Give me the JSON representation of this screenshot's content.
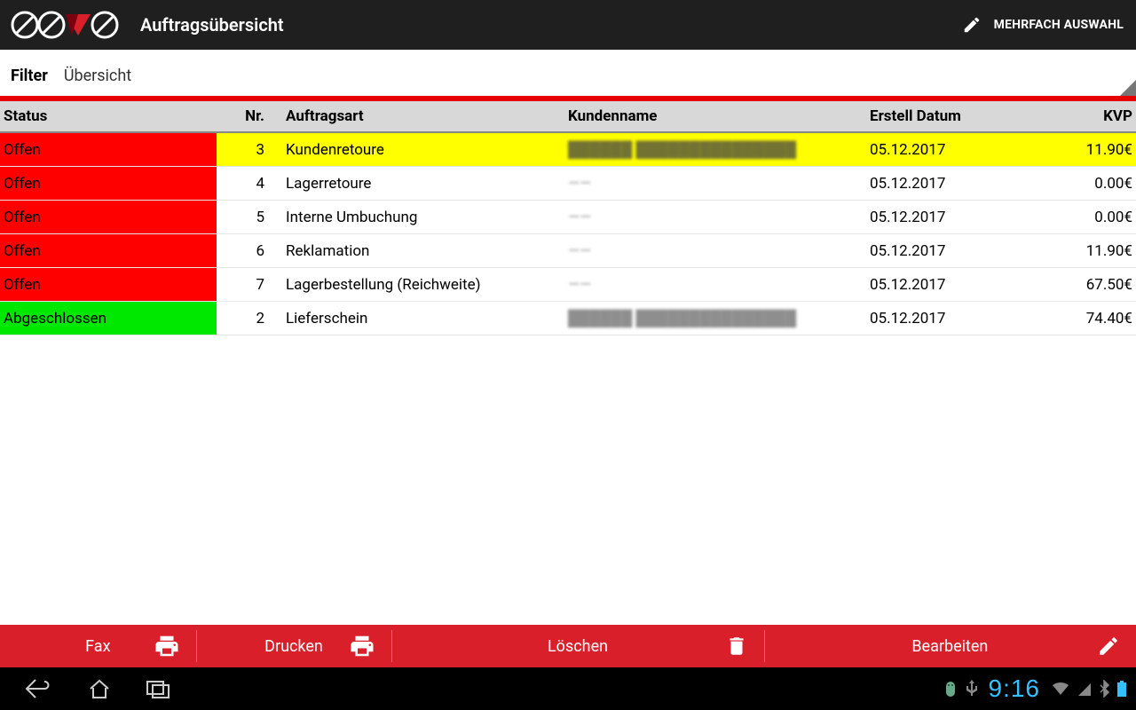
{
  "header": {
    "title": "Auftragsübersicht",
    "multi_select_label": "MEHRFACH AUSWAHL"
  },
  "filter": {
    "label": "Filter",
    "overview": "Übersicht"
  },
  "table": {
    "headers": {
      "status": "Status",
      "nr": "Nr.",
      "art": "Auftragsart",
      "kunde": "Kundenname",
      "date": "Erstell Datum",
      "kvp": "KVP"
    },
    "rows": [
      {
        "status": "Offen",
        "status_kind": "open",
        "nr": "3",
        "art": "Kundenretoure",
        "kunde": "██████ ███████████████",
        "date": "05.12.2017",
        "kvp": "11.90€",
        "selected": true
      },
      {
        "status": "Offen",
        "status_kind": "open",
        "nr": "4",
        "art": "Lagerretoure",
        "kunde": "——",
        "date": "05.12.2017",
        "kvp": "0.00€",
        "selected": false
      },
      {
        "status": "Offen",
        "status_kind": "open",
        "nr": "5",
        "art": "Interne Umbuchung",
        "kunde": "——",
        "date": "05.12.2017",
        "kvp": "0.00€",
        "selected": false
      },
      {
        "status": "Offen",
        "status_kind": "open",
        "nr": "6",
        "art": "Reklamation",
        "kunde": "——",
        "date": "05.12.2017",
        "kvp": "11.90€",
        "selected": false
      },
      {
        "status": "Offen",
        "status_kind": "open",
        "nr": "7",
        "art": "Lagerbestellung (Reichweite)",
        "kunde": "——",
        "date": "05.12.2017",
        "kvp": "67.50€",
        "selected": false
      },
      {
        "status": "Abgeschlossen",
        "status_kind": "done",
        "nr": "2",
        "art": "Lieferschein",
        "kunde": "██████ ███████████████",
        "date": "05.12.2017",
        "kvp": "74.40€",
        "selected": false
      }
    ]
  },
  "actions": {
    "fax": "Fax",
    "print": "Drucken",
    "delete": "Löschen",
    "edit": "Bearbeiten"
  },
  "navbar": {
    "time": "9:16"
  }
}
